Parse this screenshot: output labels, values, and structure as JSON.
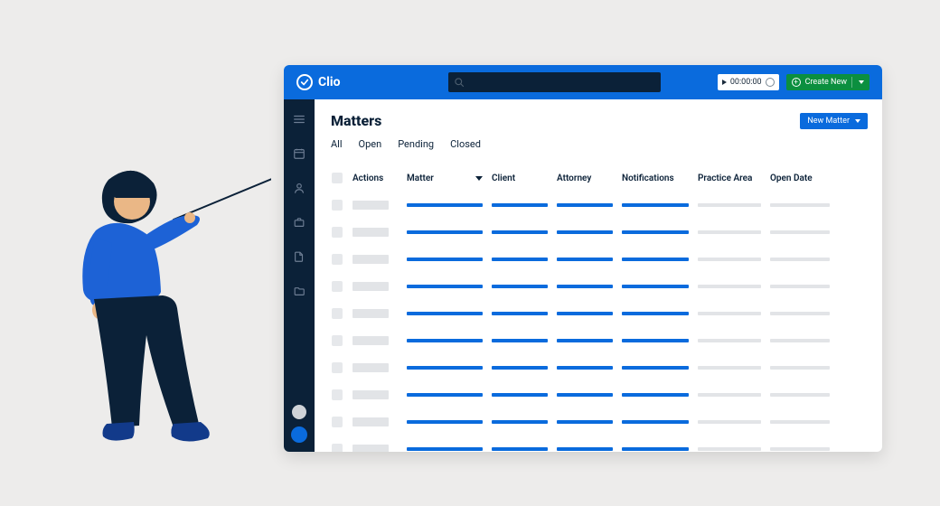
{
  "brand": {
    "name": "Clio"
  },
  "topbar": {
    "search_placeholder": "",
    "timer_value": "00:00:00",
    "create_new_label": "Create New"
  },
  "siderail": {
    "icons": [
      "menu-icon",
      "calendar-icon",
      "person-icon",
      "briefcase-icon",
      "document-icon",
      "folder-icon"
    ]
  },
  "page": {
    "title": "Matters",
    "new_button_label": "New Matter"
  },
  "tabs": [
    "All",
    "Open",
    "Pending",
    "Closed"
  ],
  "columns": {
    "actions": "Actions",
    "matter": "Matter",
    "client": "Client",
    "attorney": "Attorney",
    "notifications": "Notifications",
    "practice_area": "Practice Area",
    "open_date": "Open Date"
  },
  "row_count": 10
}
